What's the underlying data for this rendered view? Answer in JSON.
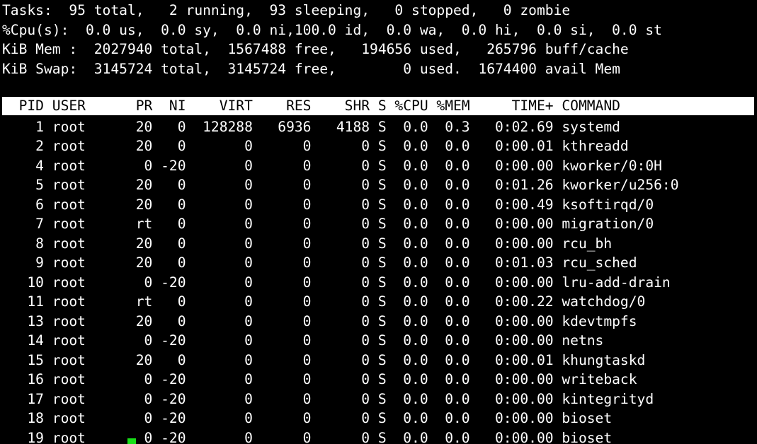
{
  "terminal": {
    "program": "top",
    "colors": {
      "background": "#000000",
      "foreground": "#ffffff",
      "header_bar_background": "#ffffff",
      "header_bar_foreground": "#000000",
      "cursor": "#18e018"
    },
    "summary": {
      "tasks": {
        "raw": "Tasks:  95 total,   2 running,  93 sleeping,   0 stopped,   0 zombie",
        "label": "Tasks:",
        "total": 95,
        "running": 2,
        "sleeping": 93,
        "stopped": 0,
        "zombie": 0
      },
      "cpu": {
        "raw": "%Cpu(s):  0.0 us,  0.0 sy,  0.0 ni,100.0 id,  0.0 wa,  0.0 hi,  0.0 si,  0.0 st",
        "label": "%Cpu(s):",
        "us": "0.0",
        "sy": "0.0",
        "ni": "0.0",
        "id": "100.0",
        "wa": "0.0",
        "hi": "0.0",
        "si": "0.0",
        "st": "0.0"
      },
      "mem": {
        "raw": "KiB Mem :  2027940 total,  1567488 free,   194656 used,   265796 buff/cache",
        "label": "KiB Mem :",
        "total": 2027940,
        "free": 1567488,
        "used": 194656,
        "buff_cache": 265796
      },
      "swap": {
        "raw": "KiB Swap:  3145724 total,  3145724 free,        0 used.  1674400 avail Mem",
        "label": "KiB Swap:",
        "total": 3145724,
        "free": 3145724,
        "used": 0,
        "avail_mem": 1674400
      }
    },
    "table": {
      "header_raw": "  PID USER      PR  NI    VIRT    RES    SHR S %CPU %MEM     TIME+ COMMAND                ",
      "columns": [
        "PID",
        "USER",
        "PR",
        "NI",
        "VIRT",
        "RES",
        "SHR",
        "S",
        "%CPU",
        "%MEM",
        "TIME+",
        "COMMAND"
      ],
      "rows": [
        {
          "raw": "    1 root      20   0  128288   6936   4188 S  0.0  0.3   0:02.69 systemd",
          "pid": "1",
          "user": "root",
          "pr": "20",
          "ni": "0",
          "virt": "128288",
          "res": "6936",
          "shr": "4188",
          "s": "S",
          "cpu": "0.0",
          "mem": "0.3",
          "time": "0:02.69",
          "command": "systemd"
        },
        {
          "raw": "    2 root      20   0       0      0      0 S  0.0  0.0   0:00.01 kthreadd",
          "pid": "2",
          "user": "root",
          "pr": "20",
          "ni": "0",
          "virt": "0",
          "res": "0",
          "shr": "0",
          "s": "S",
          "cpu": "0.0",
          "mem": "0.0",
          "time": "0:00.01",
          "command": "kthreadd"
        },
        {
          "raw": "    4 root       0 -20       0      0      0 S  0.0  0.0   0:00.00 kworker/0:0H",
          "pid": "4",
          "user": "root",
          "pr": "0",
          "ni": "-20",
          "virt": "0",
          "res": "0",
          "shr": "0",
          "s": "S",
          "cpu": "0.0",
          "mem": "0.0",
          "time": "0:00.00",
          "command": "kworker/0:0H"
        },
        {
          "raw": "    5 root      20   0       0      0      0 S  0.0  0.0   0:01.26 kworker/u256:0",
          "pid": "5",
          "user": "root",
          "pr": "20",
          "ni": "0",
          "virt": "0",
          "res": "0",
          "shr": "0",
          "s": "S",
          "cpu": "0.0",
          "mem": "0.0",
          "time": "0:01.26",
          "command": "kworker/u256:0"
        },
        {
          "raw": "    6 root      20   0       0      0      0 S  0.0  0.0   0:00.49 ksoftirqd/0",
          "pid": "6",
          "user": "root",
          "pr": "20",
          "ni": "0",
          "virt": "0",
          "res": "0",
          "shr": "0",
          "s": "S",
          "cpu": "0.0",
          "mem": "0.0",
          "time": "0:00.49",
          "command": "ksoftirqd/0"
        },
        {
          "raw": "    7 root      rt   0       0      0      0 S  0.0  0.0   0:00.00 migration/0",
          "pid": "7",
          "user": "root",
          "pr": "rt",
          "ni": "0",
          "virt": "0",
          "res": "0",
          "shr": "0",
          "s": "S",
          "cpu": "0.0",
          "mem": "0.0",
          "time": "0:00.00",
          "command": "migration/0"
        },
        {
          "raw": "    8 root      20   0       0      0      0 S  0.0  0.0   0:00.00 rcu_bh",
          "pid": "8",
          "user": "root",
          "pr": "20",
          "ni": "0",
          "virt": "0",
          "res": "0",
          "shr": "0",
          "s": "S",
          "cpu": "0.0",
          "mem": "0.0",
          "time": "0:00.00",
          "command": "rcu_bh"
        },
        {
          "raw": "    9 root      20   0       0      0      0 S  0.0  0.0   0:01.03 rcu_sched",
          "pid": "9",
          "user": "root",
          "pr": "20",
          "ni": "0",
          "virt": "0",
          "res": "0",
          "shr": "0",
          "s": "S",
          "cpu": "0.0",
          "mem": "0.0",
          "time": "0:01.03",
          "command": "rcu_sched"
        },
        {
          "raw": "   10 root       0 -20       0      0      0 S  0.0  0.0   0:00.00 lru-add-drain",
          "pid": "10",
          "user": "root",
          "pr": "0",
          "ni": "-20",
          "virt": "0",
          "res": "0",
          "shr": "0",
          "s": "S",
          "cpu": "0.0",
          "mem": "0.0",
          "time": "0:00.00",
          "command": "lru-add-drain"
        },
        {
          "raw": "   11 root      rt   0       0      0      0 S  0.0  0.0   0:00.22 watchdog/0",
          "pid": "11",
          "user": "root",
          "pr": "rt",
          "ni": "0",
          "virt": "0",
          "res": "0",
          "shr": "0",
          "s": "S",
          "cpu": "0.0",
          "mem": "0.0",
          "time": "0:00.22",
          "command": "watchdog/0"
        },
        {
          "raw": "   13 root      20   0       0      0      0 S  0.0  0.0   0:00.00 kdevtmpfs",
          "pid": "13",
          "user": "root",
          "pr": "20",
          "ni": "0",
          "virt": "0",
          "res": "0",
          "shr": "0",
          "s": "S",
          "cpu": "0.0",
          "mem": "0.0",
          "time": "0:00.00",
          "command": "kdevtmpfs"
        },
        {
          "raw": "   14 root       0 -20       0      0      0 S  0.0  0.0   0:00.00 netns",
          "pid": "14",
          "user": "root",
          "pr": "0",
          "ni": "-20",
          "virt": "0",
          "res": "0",
          "shr": "0",
          "s": "S",
          "cpu": "0.0",
          "mem": "0.0",
          "time": "0:00.00",
          "command": "netns"
        },
        {
          "raw": "   15 root      20   0       0      0      0 S  0.0  0.0   0:00.01 khungtaskd",
          "pid": "15",
          "user": "root",
          "pr": "20",
          "ni": "0",
          "virt": "0",
          "res": "0",
          "shr": "0",
          "s": "S",
          "cpu": "0.0",
          "mem": "0.0",
          "time": "0:00.01",
          "command": "khungtaskd"
        },
        {
          "raw": "   16 root       0 -20       0      0      0 S  0.0  0.0   0:00.00 writeback",
          "pid": "16",
          "user": "root",
          "pr": "0",
          "ni": "-20",
          "virt": "0",
          "res": "0",
          "shr": "0",
          "s": "S",
          "cpu": "0.0",
          "mem": "0.0",
          "time": "0:00.00",
          "command": "writeback"
        },
        {
          "raw": "   17 root       0 -20       0      0      0 S  0.0  0.0   0:00.00 kintegrityd",
          "pid": "17",
          "user": "root",
          "pr": "0",
          "ni": "-20",
          "virt": "0",
          "res": "0",
          "shr": "0",
          "s": "S",
          "cpu": "0.0",
          "mem": "0.0",
          "time": "0:00.00",
          "command": "kintegrityd"
        },
        {
          "raw": "   18 root       0 -20       0      0      0 S  0.0  0.0   0:00.00 bioset",
          "pid": "18",
          "user": "root",
          "pr": "0",
          "ni": "-20",
          "virt": "0",
          "res": "0",
          "shr": "0",
          "s": "S",
          "cpu": "0.0",
          "mem": "0.0",
          "time": "0:00.00",
          "command": "bioset"
        },
        {
          "raw": "   19 root       0 -20       0      0      0 S  0.0  0.0   0:00.00 bioset",
          "pid": "19",
          "user": "root",
          "pr": "0",
          "ni": "-20",
          "virt": "0",
          "res": "0",
          "shr": "0",
          "s": "S",
          "cpu": "0.0",
          "mem": "0.0",
          "time": "0:00.00",
          "command": "bioset"
        }
      ]
    }
  }
}
